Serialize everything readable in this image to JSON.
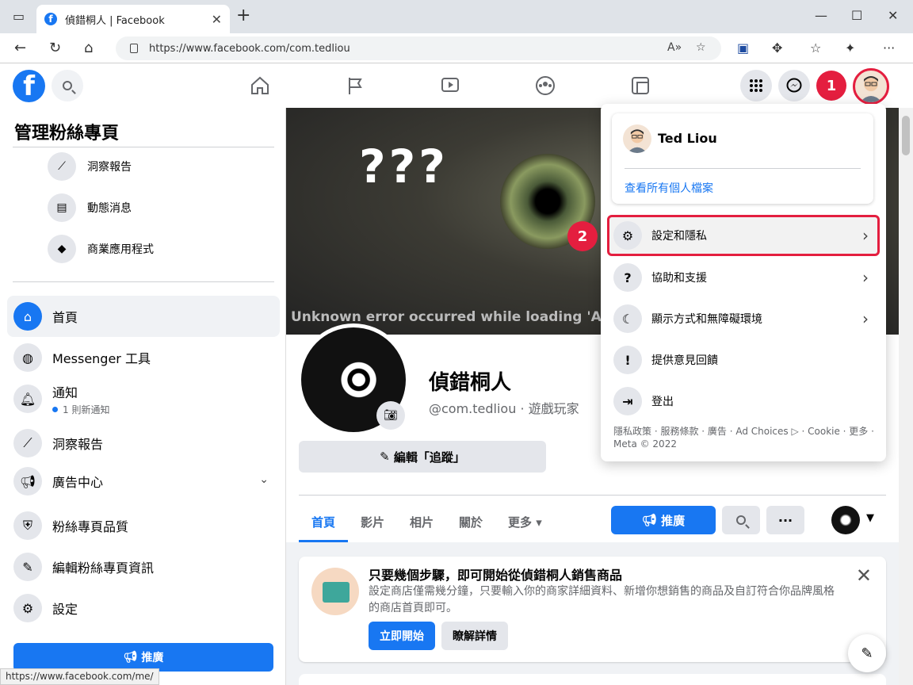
{
  "browser": {
    "tab_title": "偵錯桐人 | Facebook",
    "url": "https://www.facebook.com/com.tedliou",
    "status_url": "https://www.facebook.com/me/"
  },
  "sidebar": {
    "title": "管理粉絲專頁",
    "sub_items": [
      {
        "label": "洞察報告",
        "icon": "insights-icon"
      },
      {
        "label": "動態消息",
        "icon": "news-feed-icon"
      },
      {
        "label": "商業應用程式",
        "icon": "cube-icon"
      }
    ],
    "items": [
      {
        "label": "首頁",
        "icon": "home-icon",
        "active": true
      },
      {
        "label": "Messenger 工具",
        "icon": "messenger-icon"
      },
      {
        "label": "通知",
        "icon": "bell-icon",
        "sub": "1 則新通知"
      },
      {
        "label": "洞察報告",
        "icon": "insights-icon"
      },
      {
        "label": "廣告中心",
        "icon": "megaphone-icon"
      },
      {
        "label": "粉絲專頁品質",
        "icon": "shield-icon"
      },
      {
        "label": "編輯粉絲專頁資訊",
        "icon": "pencil-icon"
      },
      {
        "label": "設定",
        "icon": "gear-icon"
      }
    ],
    "promote_label": "推廣"
  },
  "cover": {
    "question": "???",
    "error_text": "Unknown error occurred while loading 'Asse"
  },
  "profile": {
    "name": "偵錯桐人",
    "handle": "@com.tedliou · 遊戲玩家",
    "edit_label": "編輯「追蹤」",
    "tabs": [
      "首頁",
      "影片",
      "相片",
      "關於",
      "更多"
    ],
    "promote_label": "推廣"
  },
  "card": {
    "title": "只要幾個步驟，即可開始從偵錯桐人銷售商品",
    "desc": "設定商店僅需幾分鐘，只要輸入你的商家詳細資料、新增你想銷售的商品及自訂符合你品牌風格的商店首頁即可。",
    "primary": "立即開始",
    "secondary": "瞭解詳情"
  },
  "menu": {
    "user_name": "Ted Liou",
    "view_profiles": "查看所有個人檔案",
    "items": [
      {
        "label": "設定和隱私",
        "icon": "gear-icon",
        "arrow": true
      },
      {
        "label": "協助和支援",
        "icon": "help-icon",
        "arrow": true
      },
      {
        "label": "顯示方式和無障礙環境",
        "icon": "moon-icon",
        "arrow": true
      },
      {
        "label": "提供意見回饋",
        "icon": "feedback-icon",
        "arrow": false
      },
      {
        "label": "登出",
        "icon": "logout-icon",
        "arrow": false
      }
    ],
    "footer": "隱私政策 · 服務條款 · 廣告 · Ad Choices ▷ · Cookie · 更多 · Meta © 2022"
  },
  "annotations": {
    "step1": "1",
    "step2": "2"
  },
  "colors": {
    "brand": "#1877f2",
    "annotation": "#e41e3f"
  }
}
